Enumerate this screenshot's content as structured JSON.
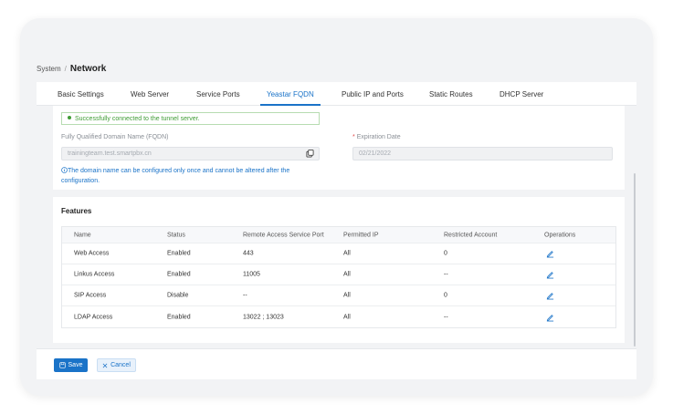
{
  "breadcrumb": {
    "parent": "System",
    "separator": "/",
    "current": "Network"
  },
  "tabs": [
    {
      "label": "Basic Settings"
    },
    {
      "label": "Web Server"
    },
    {
      "label": "Service Ports"
    },
    {
      "label": "Yeastar FQDN",
      "active": true
    },
    {
      "label": "Public IP and Ports"
    },
    {
      "label": "Static Routes"
    },
    {
      "label": "DHCP Server"
    }
  ],
  "fqdn": {
    "status_text": "Successfully connected to the tunnel server.",
    "fqdn_label": "Fully Qualified Domain Name (FQDN)",
    "fqdn_value": "trainingteam.test.smartpbx.cn",
    "expiration_label": "Expiration Date",
    "expiration_required_mark": "*",
    "expiration_value": "02/21/2022",
    "note": "The domain name can be configured only once and cannot be altered after the configuration."
  },
  "features": {
    "title": "Features",
    "columns": [
      "Name",
      "Status",
      "Remote Access Service Port",
      "Permitted IP",
      "Restricted Account",
      "Operations"
    ],
    "rows": [
      {
        "name": "Web Access",
        "status": "Enabled",
        "port": "443",
        "permitted_ip": "All",
        "restricted": "0"
      },
      {
        "name": "Linkus Access",
        "status": "Enabled",
        "port": "11005",
        "permitted_ip": "All",
        "restricted": "--"
      },
      {
        "name": "SIP Access",
        "status": "Disable",
        "port": "--",
        "permitted_ip": "All",
        "restricted": "0"
      },
      {
        "name": "LDAP Access",
        "status": "Enabled",
        "port": "13022 ; 13023",
        "permitted_ip": "All",
        "restricted": "--"
      }
    ]
  },
  "footer": {
    "save_label": "Save",
    "cancel_label": "Cancel"
  },
  "colors": {
    "accent": "#1a73c8",
    "success": "#3f9c35",
    "required": "#e04b4b"
  }
}
